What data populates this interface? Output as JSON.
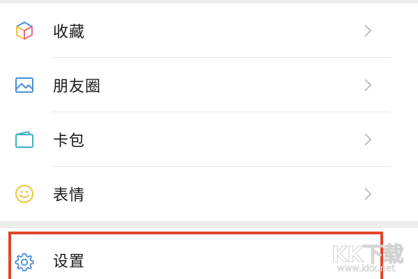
{
  "menu": {
    "items": [
      {
        "label": "收藏",
        "icon": "favorites-cube-icon"
      },
      {
        "label": "朋友圈",
        "icon": "moments-image-icon"
      },
      {
        "label": "卡包",
        "icon": "card-wallet-icon"
      },
      {
        "label": "表情",
        "icon": "sticker-smiley-icon"
      }
    ]
  },
  "settings": {
    "label": "设置",
    "icon": "gear-icon"
  },
  "watermark": {
    "logo": "KK下载",
    "url": "www.kkx.net"
  },
  "colors": {
    "highlight": "#e0452a",
    "icon_blue": "#4a8fd6",
    "icon_yellow": "#f0c53c",
    "icon_teal": "#3cb1c6",
    "chevron": "#bfbfbf"
  }
}
